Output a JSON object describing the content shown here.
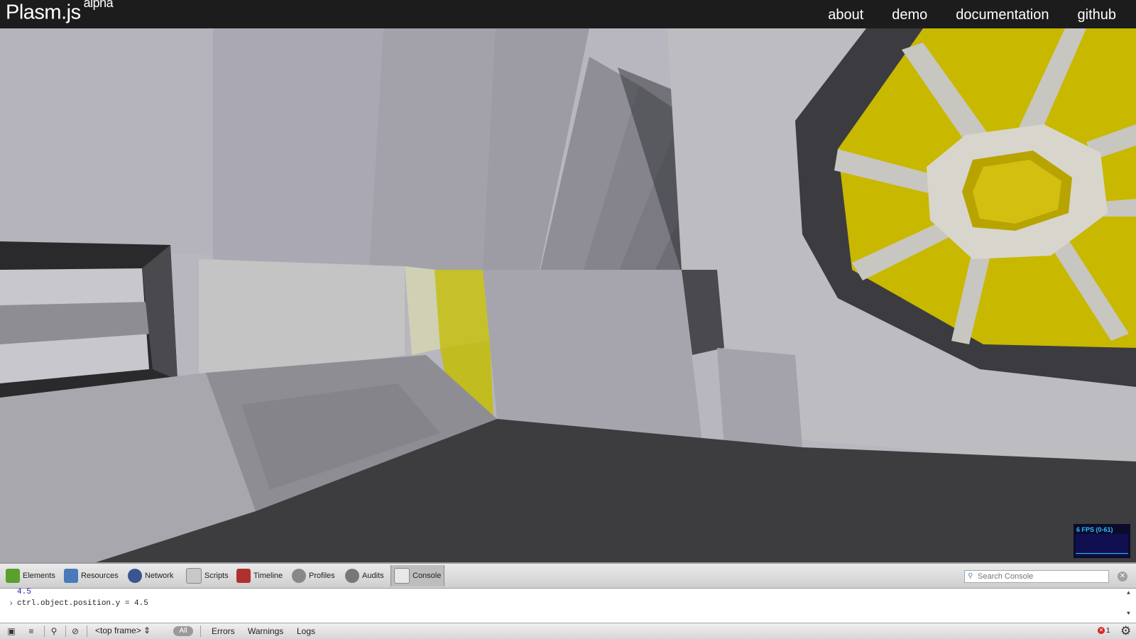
{
  "nav": {
    "brand": "Plasm.js",
    "brand_tag": "alpha",
    "links": [
      "about",
      "demo",
      "documentation",
      "github"
    ]
  },
  "scene": {
    "fps_label": "6 FPS (0-61)",
    "colors": {
      "yellow": "#c8b800",
      "dark": "#3a3a3a",
      "light": "#b8b6bf",
      "floor": "#9c9aa4"
    }
  },
  "devtools": {
    "tabs": [
      {
        "label": "Elements",
        "icon": "elements-icon"
      },
      {
        "label": "Resources",
        "icon": "resources-icon"
      },
      {
        "label": "Network",
        "icon": "network-icon"
      },
      {
        "label": "Scripts",
        "icon": "scripts-icon"
      },
      {
        "label": "Timeline",
        "icon": "timeline-icon"
      },
      {
        "label": "Profiles",
        "icon": "profiles-icon"
      },
      {
        "label": "Audits",
        "icon": "audits-icon"
      },
      {
        "label": "Console",
        "icon": "console-icon",
        "active": true
      }
    ],
    "search_placeholder": "Search Console",
    "console": {
      "result": "4.5",
      "prompt": "›",
      "input": "ctrl.object.position.y = 4.5"
    },
    "status": {
      "frame": "<top frame>",
      "filter_all": "All",
      "filters": [
        "Errors",
        "Warnings",
        "Logs"
      ],
      "error_count": "1"
    }
  }
}
